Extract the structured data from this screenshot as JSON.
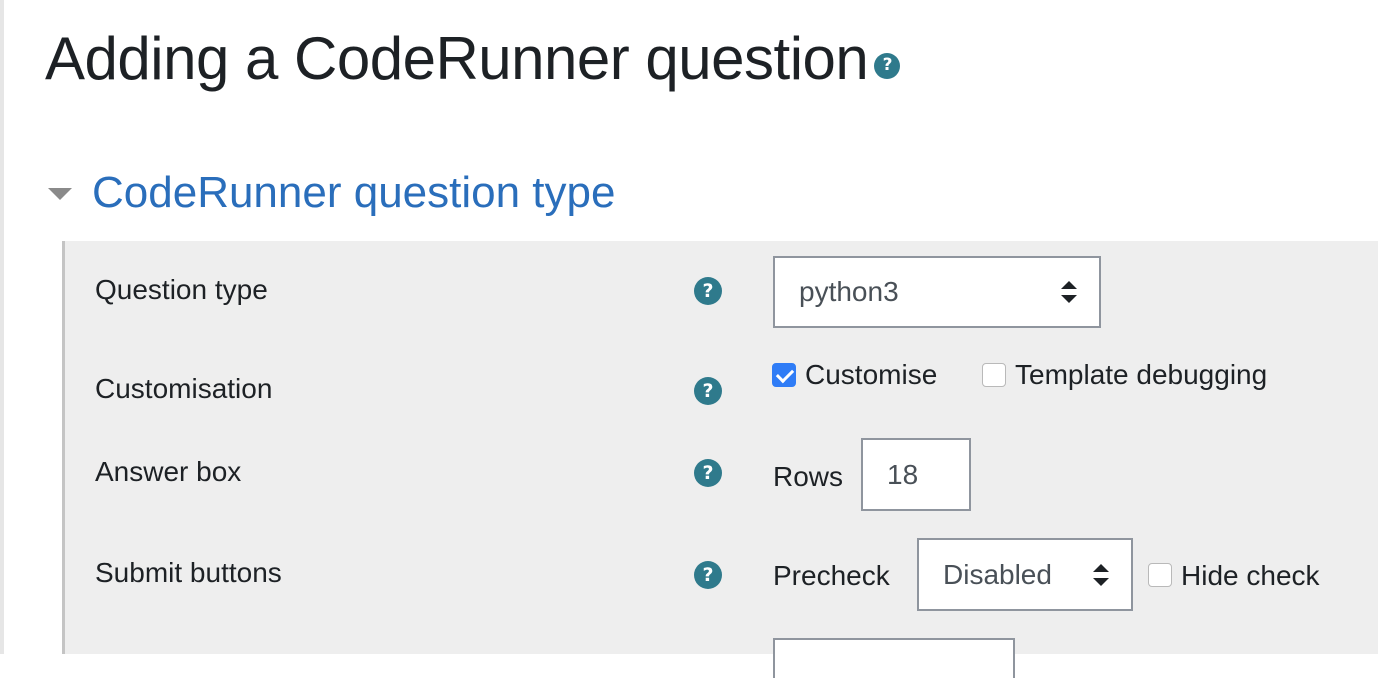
{
  "page": {
    "title": "Adding a CodeRunner question",
    "title_help_icon": "help-icon"
  },
  "section": {
    "title": "CodeRunner question type",
    "collapse_icon": "caret-down-icon",
    "colors": {
      "link": "#2a6ebb",
      "help": "#2f7a8c",
      "checkbox": "#2f7cf6",
      "panel": "#eeeeee"
    }
  },
  "rows": {
    "question_type": {
      "label": "Question type",
      "value": "python3"
    },
    "customisation": {
      "label": "Customisation",
      "customise": {
        "label": "Customise",
        "checked": true
      },
      "template_debugging": {
        "label": "Template debugging",
        "checked": false
      }
    },
    "answer_box": {
      "label": "Answer box",
      "rows_label": "Rows",
      "rows_value": "18"
    },
    "submit_buttons": {
      "label": "Submit buttons",
      "precheck_label": "Precheck",
      "precheck_value": "Disabled",
      "hide_check": {
        "label": "Hide check",
        "checked": false
      }
    }
  }
}
